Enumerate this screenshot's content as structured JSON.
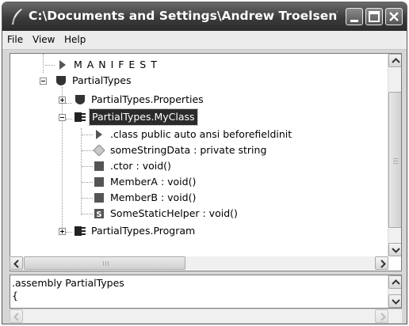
{
  "window": {
    "title": "C:\\Documents and Settings\\Andrew Troelsen\\M...",
    "title_icon": "feather-quill-icon"
  },
  "menu": {
    "items": [
      "File",
      "View",
      "Help"
    ]
  },
  "tree": {
    "nodes": [
      {
        "label": "M A N I F E S T",
        "icon": "arrow-right-icon"
      },
      {
        "label": "PartialTypes",
        "icon": "namespace-shield-icon",
        "expanded": true
      },
      {
        "label": "PartialTypes.Properties",
        "icon": "namespace-shield-icon",
        "expanded": false
      },
      {
        "label": "PartialTypes.MyClass",
        "icon": "class-icon",
        "expanded": true,
        "selected": true
      },
      {
        "label": ".class public auto ansi beforefieldinit",
        "icon": "arrow-right-icon"
      },
      {
        "label": "someStringData : private string",
        "icon": "field-diamond-icon"
      },
      {
        "label": ".ctor : void()",
        "icon": "method-square-icon"
      },
      {
        "label": "MemberA : void()",
        "icon": "method-square-icon"
      },
      {
        "label": "MemberB : void()",
        "icon": "method-square-icon"
      },
      {
        "label": "SomeStaticHelper : void()",
        "icon": "static-method-icon"
      },
      {
        "label": "PartialTypes.Program",
        "icon": "class-icon",
        "expanded": false
      }
    ]
  },
  "detail": {
    "lines": [
      ".assembly PartialTypes",
      "{"
    ]
  },
  "colors": {
    "titlebar": "#3b3b3b",
    "selection": "#2b2b2b",
    "window_bg": "#d6d6d6"
  }
}
